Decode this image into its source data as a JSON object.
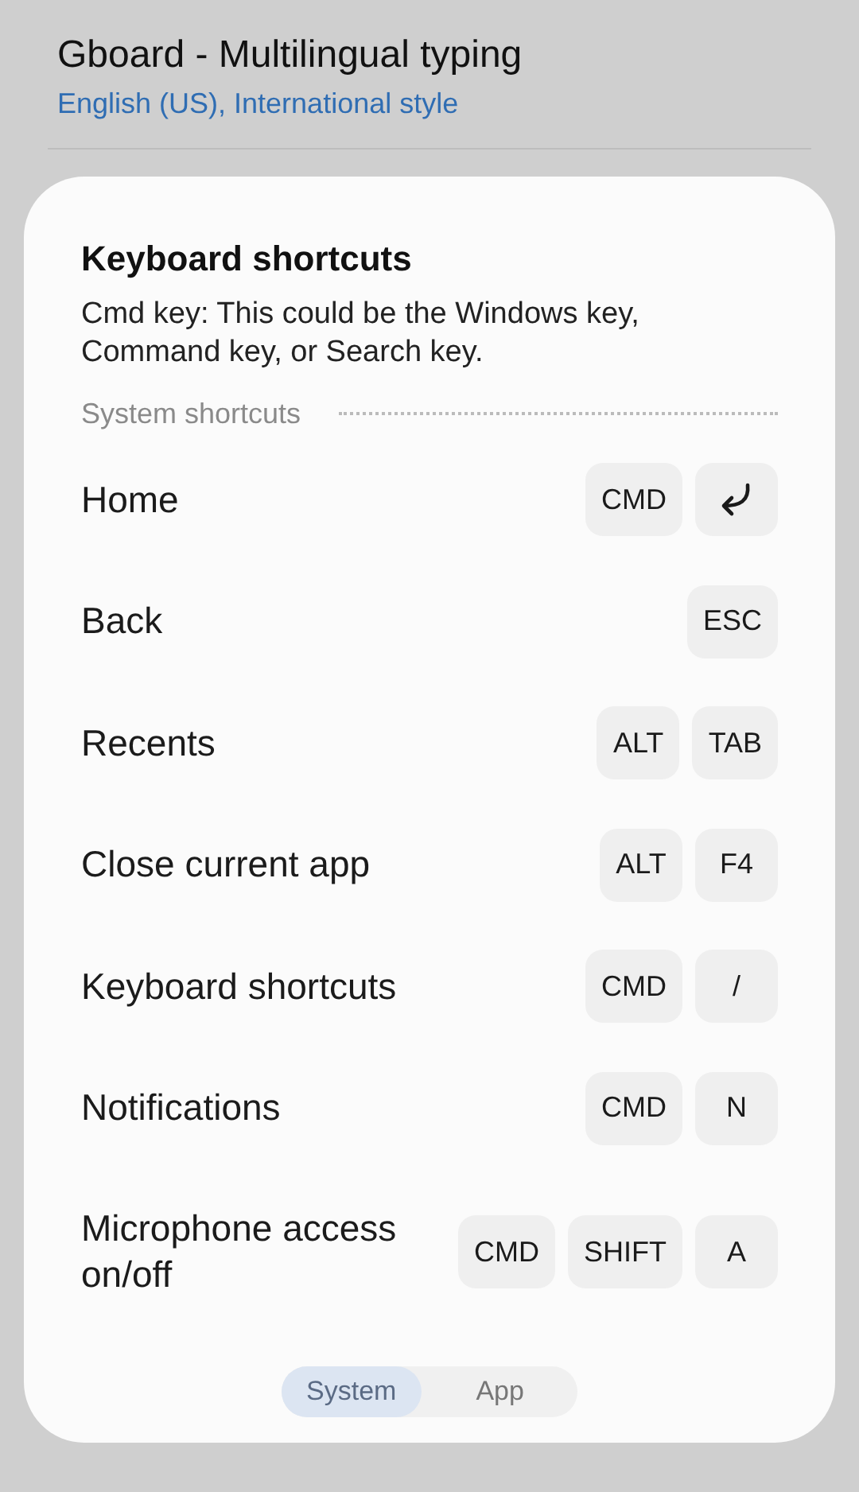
{
  "header": {
    "title": "Gboard - Multilingual typing",
    "subtitle": "English (US), International style"
  },
  "dialog": {
    "title": "Keyboard shortcuts",
    "description": "Cmd key: This could be the Windows key, Command key, or Search key.",
    "section": "System shortcuts",
    "shortcuts": [
      {
        "label": "Home",
        "keys": [
          {
            "kind": "text",
            "text": "CMD"
          },
          {
            "kind": "enter"
          }
        ]
      },
      {
        "label": "Back",
        "keys": [
          {
            "kind": "text",
            "text": "ESC"
          }
        ]
      },
      {
        "label": "Recents",
        "keys": [
          {
            "kind": "text",
            "text": "ALT"
          },
          {
            "kind": "text",
            "text": "TAB"
          }
        ]
      },
      {
        "label": "Close current app",
        "keys": [
          {
            "kind": "text",
            "text": "ALT"
          },
          {
            "kind": "text",
            "text": "F4"
          }
        ]
      },
      {
        "label": "Keyboard shortcuts",
        "keys": [
          {
            "kind": "text",
            "text": "CMD"
          },
          {
            "kind": "text",
            "text": "/"
          }
        ]
      },
      {
        "label": "Notifications",
        "keys": [
          {
            "kind": "text",
            "text": "CMD"
          },
          {
            "kind": "text",
            "text": "N"
          }
        ]
      },
      {
        "label": "Microphone access on/off",
        "keys": [
          {
            "kind": "text",
            "text": "CMD"
          },
          {
            "kind": "text",
            "text": "SHIFT"
          },
          {
            "kind": "text",
            "text": "A"
          }
        ]
      }
    ],
    "tabs": [
      {
        "label": "System",
        "selected": true
      },
      {
        "label": "App",
        "selected": false
      }
    ]
  }
}
